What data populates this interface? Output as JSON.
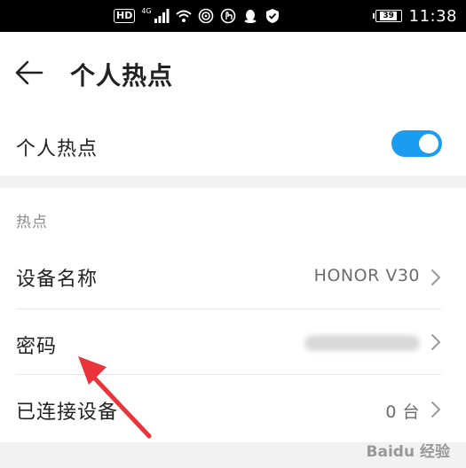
{
  "status_bar": {
    "hd": "HD",
    "network": "4G",
    "battery": "39",
    "time": "11:38"
  },
  "header": {
    "title": "个人热点"
  },
  "hotspot_toggle": {
    "label": "个人热点",
    "enabled": true
  },
  "section": {
    "title": "热点"
  },
  "rows": [
    {
      "label": "设备名称",
      "value": "HONOR V30"
    },
    {
      "label": "密码",
      "value": ""
    },
    {
      "label": "已连接设备",
      "value": "0 台"
    }
  ],
  "watermark": "Baidu 经验",
  "colors": {
    "accent": "#1a9cf0",
    "annotation_arrow": "#e8343a"
  }
}
